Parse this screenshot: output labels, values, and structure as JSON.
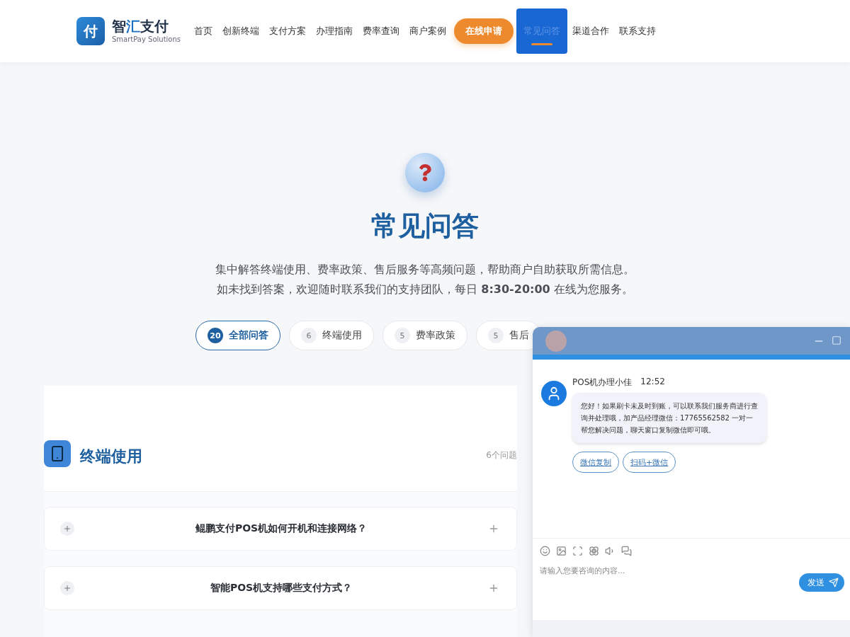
{
  "header": {
    "logo_mark": "付",
    "brand_prefix": "智",
    "brand_accent": "汇",
    "brand_suffix": "支付",
    "tagline": "SmartPay Solutions",
    "nav": [
      {
        "label": "首页",
        "kind": "link",
        "selected": false
      },
      {
        "label": "创新终端",
        "kind": "link",
        "selected": false
      },
      {
        "label": "支付方案",
        "kind": "link",
        "selected": false
      },
      {
        "label": "办理指南",
        "kind": "link",
        "selected": false
      },
      {
        "label": "费率查询",
        "kind": "link",
        "selected": false
      },
      {
        "label": "商户案例",
        "kind": "link",
        "selected": false
      },
      {
        "label": "在线申请",
        "kind": "cta",
        "selected": false
      },
      {
        "label": "常见问答",
        "kind": "link",
        "selected": true
      },
      {
        "label": "渠道合作",
        "kind": "link",
        "selected": false
      },
      {
        "label": "联系支持",
        "kind": "link",
        "selected": false
      }
    ]
  },
  "hero": {
    "title": "常见问答",
    "description": "集中解答终端使用、费率政策、售后服务等高频问题，帮助商户自助获取所需信息。如未找到答案，欢迎随时联系我们的支持团队，每日 **8:30-20:00** 在线为您服务。"
  },
  "filters": [
    {
      "count": "20",
      "label": "全部问答",
      "selected": true
    },
    {
      "count": "6",
      "label": "终端使用",
      "selected": false
    },
    {
      "count": "5",
      "label": "费率政策",
      "selected": false
    },
    {
      "count": "5",
      "label": "售后",
      "selected": false
    }
  ],
  "section": {
    "title": "终端使用",
    "count": "6个问题",
    "questions": [
      {
        "text": "鲲鹏支付POS机如何开机和连接网络？",
        "expanded": false
      },
      {
        "text": "智能POS机支持哪些支付方式？",
        "expanded": false
      }
    ]
  },
  "chat": {
    "messages": [
      {
        "sender": "POS机办理小佳",
        "time": "12:52",
        "text": "您好！如果刷卡未及时到账，可以联系我们服务商进行查询并处理哦，加产品经理微信：17765562582 一对一帮您解决问题，聊天窗口复制微信即可哦。"
      }
    ],
    "actions": [
      "微信复制",
      "扫码+微信"
    ],
    "input": {
      "placeholder": "请输入您要咨询的内容..."
    },
    "send_label": "发送"
  }
}
